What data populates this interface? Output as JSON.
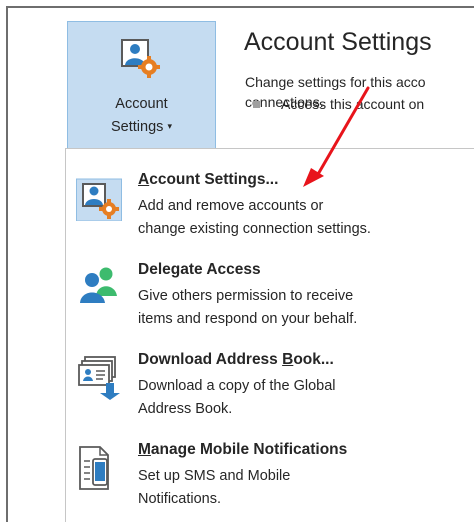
{
  "ribbon": {
    "button_line1": "Account",
    "button_line2": "Settings",
    "button_caret": "▾",
    "title": "Account Settings",
    "desc_line1": "Change settings for this acco",
    "desc_line2": "connections.",
    "access_text": "Access this account on"
  },
  "menu": {
    "items": [
      {
        "title_u": "A",
        "title_rest": "ccount Settings...",
        "desc1": "Add and remove accounts or",
        "desc2": "change existing connection settings.",
        "icon": "account-settings-icon"
      },
      {
        "title_pre": "Dele",
        "title_u": "g",
        "title_rest": "ate Access",
        "desc1": "Give others permission to receive",
        "desc2": "items and respond on your behalf.",
        "icon": "delegate-access-icon"
      },
      {
        "title_pre": "Download Address ",
        "title_u": "B",
        "title_rest": "ook...",
        "desc1": "Download a copy of the Global",
        "desc2": "Address Book.",
        "icon": "address-book-icon"
      },
      {
        "title_u": "M",
        "title_rest": "anage Mobile Notifications",
        "desc1": "Set up SMS and Mobile",
        "desc2": "Notifications.",
        "icon": "mobile-notifications-icon"
      }
    ]
  },
  "colors": {
    "accent_blue": "#c5dcf1",
    "arrow_red": "#e8141b"
  }
}
